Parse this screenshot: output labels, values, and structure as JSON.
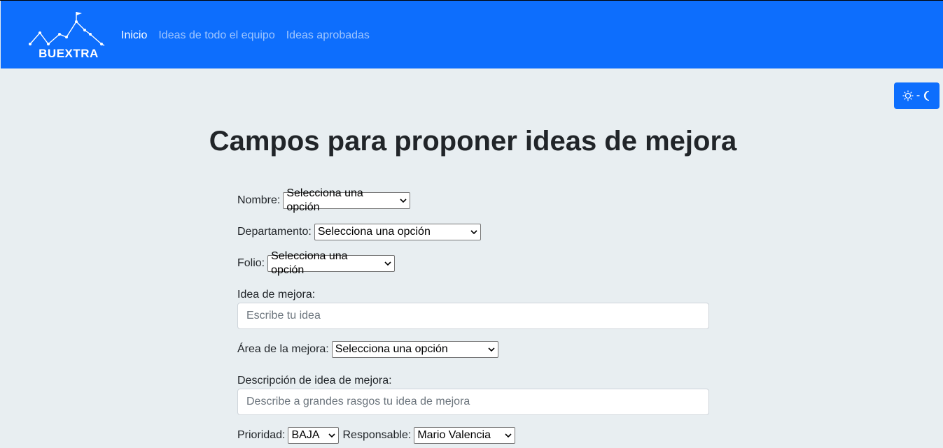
{
  "brand": {
    "logo_text": "BUEXTRA"
  },
  "nav": {
    "items": [
      {
        "label": "Inicio",
        "active": true
      },
      {
        "label": "Ideas de todo el equipo",
        "active": false
      },
      {
        "label": "Ideas aprobadas",
        "active": false
      }
    ]
  },
  "theme_toggle": {
    "label": "☼ - ☾"
  },
  "page": {
    "title": "Campos para proponer ideas de mejora"
  },
  "form": {
    "nombre": {
      "label": "Nombre:",
      "value": "Selecciona una opción"
    },
    "departamento": {
      "label": "Departamento:",
      "value": "Selecciona una opción"
    },
    "folio": {
      "label": "Folio:",
      "value": "Selecciona una opción"
    },
    "idea": {
      "label": "Idea de mejora:",
      "placeholder": "Escribe tu idea"
    },
    "area": {
      "label": "Área de la mejora:",
      "value": "Selecciona una opción"
    },
    "descripcion": {
      "label": "Descripción de idea de mejora:",
      "placeholder": "Describe a grandes rasgos tu idea de mejora"
    },
    "prioridad": {
      "label": "Prioridad:",
      "value": "BAJA"
    },
    "responsable": {
      "label": "Responsable:",
      "value": "Mario Valencia"
    }
  },
  "colors": {
    "navbar": "#0d6efd",
    "background": "#e8eef1"
  }
}
